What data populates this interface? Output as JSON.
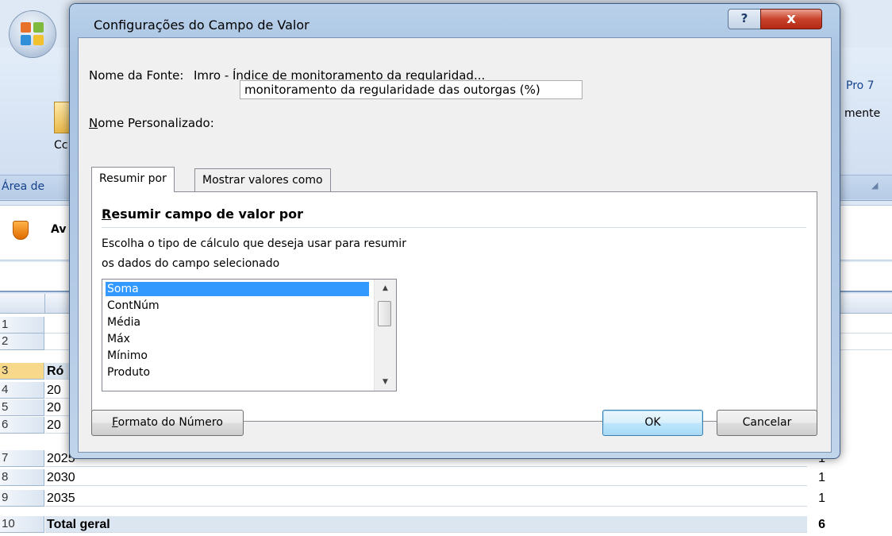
{
  "background": {
    "ribbon_texts": {
      "right_tab": "Pro 7",
      "right_cmd": "mente",
      "left_cmd": "Cc",
      "group_label": "Área de",
      "msg_text": "Av"
    },
    "rows": [
      {
        "num": "1",
        "label": "",
        "value": ""
      },
      {
        "num": "2",
        "label": "",
        "value": ""
      },
      {
        "num": "3",
        "label": "Ró",
        "value": ""
      },
      {
        "num": "4",
        "label": "20",
        "value": ""
      },
      {
        "num": "5",
        "label": "20",
        "value": ""
      },
      {
        "num": "6",
        "label": "20",
        "value": ""
      },
      {
        "num": "7",
        "label": "2025",
        "value": "1"
      },
      {
        "num": "8",
        "label": "2030",
        "value": "1"
      },
      {
        "num": "9",
        "label": "2035",
        "value": "1"
      },
      {
        "num": "10",
        "label": "Total geral",
        "value": "6"
      }
    ]
  },
  "dialog": {
    "title": "Configurações do Campo de Valor",
    "help_label": "?",
    "close_label": "x",
    "source_label": "Nome da Fonte:",
    "source_value": "Imro - Índice de monitoramento da regularidad...",
    "custom_label_underlined": "N",
    "custom_label_rest": "ome Personalizado:",
    "custom_value": "monitoramento da regularidade das outorgas (%)",
    "tabs": [
      {
        "label": "Resumir por",
        "active": true
      },
      {
        "label": "Mostrar valores como",
        "active": false
      }
    ],
    "section_title_underlined": "R",
    "section_title_rest": "esumir campo de valor por",
    "instruction_line1": "Escolha o tipo de cálculo que deseja usar para resumir",
    "instruction_line2": "os dados do campo selecionado",
    "options": [
      "Soma",
      "ContNúm",
      "Média",
      "Máx",
      "Mínimo",
      "Produto"
    ],
    "selected_option": "Soma",
    "number_format_underlined": "F",
    "number_format_rest": "ormato do Número",
    "ok_label": "OK",
    "cancel_label": "Cancelar"
  }
}
